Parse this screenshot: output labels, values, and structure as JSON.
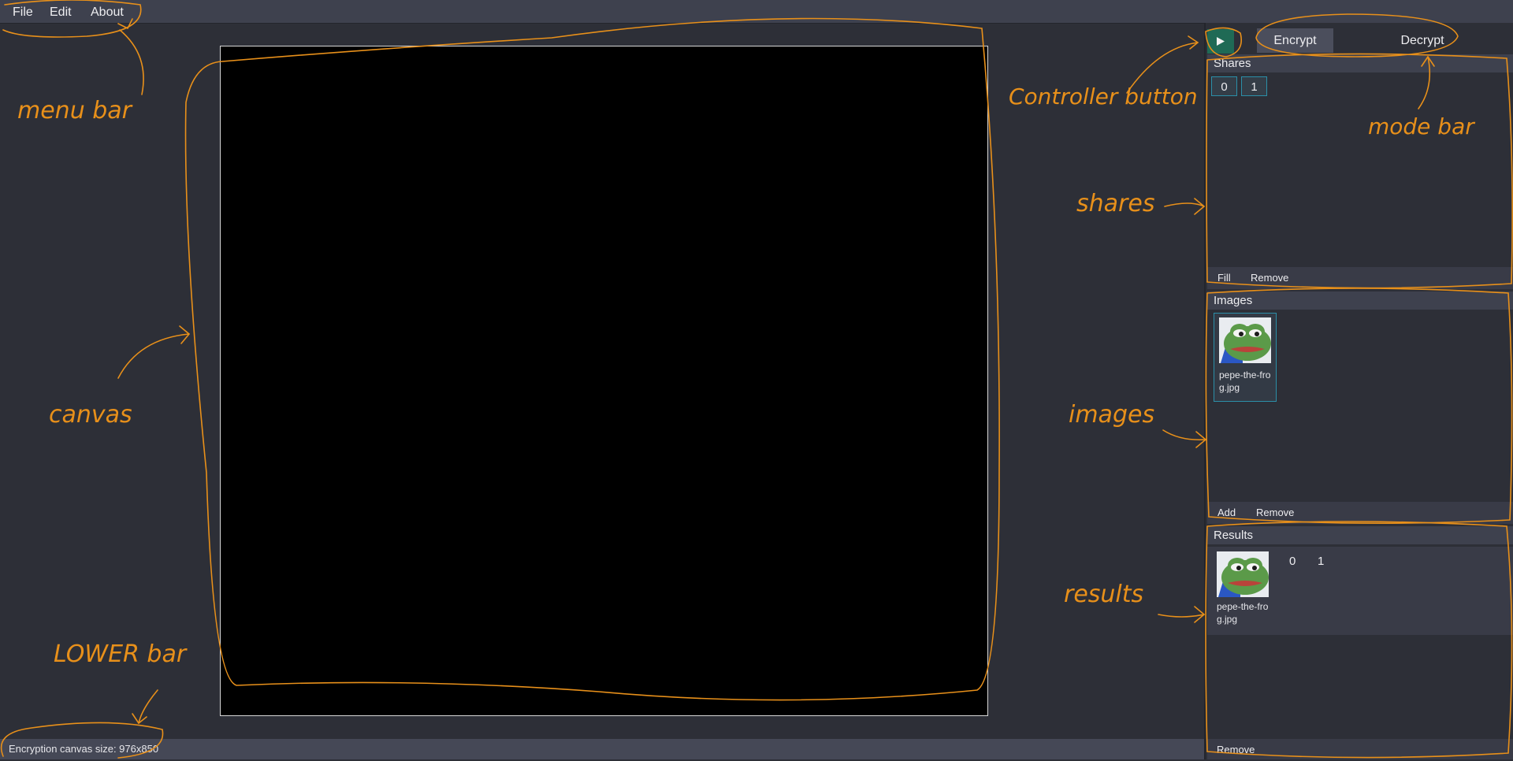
{
  "menu": {
    "file": "File",
    "edit": "Edit",
    "about": "About"
  },
  "status": {
    "text": "Encryption canvas size: 976x850"
  },
  "mode_bar": {
    "encrypt": "Encrypt",
    "decrypt": "Decrypt"
  },
  "controller": {
    "icon": "play-icon"
  },
  "shares": {
    "title": "Shares",
    "items": [
      "0",
      "1"
    ],
    "fill": "Fill",
    "remove": "Remove"
  },
  "images": {
    "title": "Images",
    "items": [
      {
        "filename": "pepe-the-frog.jpg"
      }
    ],
    "add": "Add",
    "remove": "Remove"
  },
  "results": {
    "title": "Results",
    "items": [
      {
        "filename": "pepe-the-frog.jpg",
        "shares": [
          "0",
          "1"
        ]
      }
    ],
    "remove": "Remove"
  },
  "annotations": {
    "menu_bar": "menu bar",
    "canvas": "canvas",
    "lower_bar": "LOWER bar",
    "controller_button": "Controller button",
    "mode_bar": "mode bar",
    "shares": "shares",
    "images": "images",
    "results": "results"
  },
  "colors": {
    "accent": "#2b8fa8",
    "play_button": "#1f6a55",
    "annotation": "#e8901a"
  }
}
